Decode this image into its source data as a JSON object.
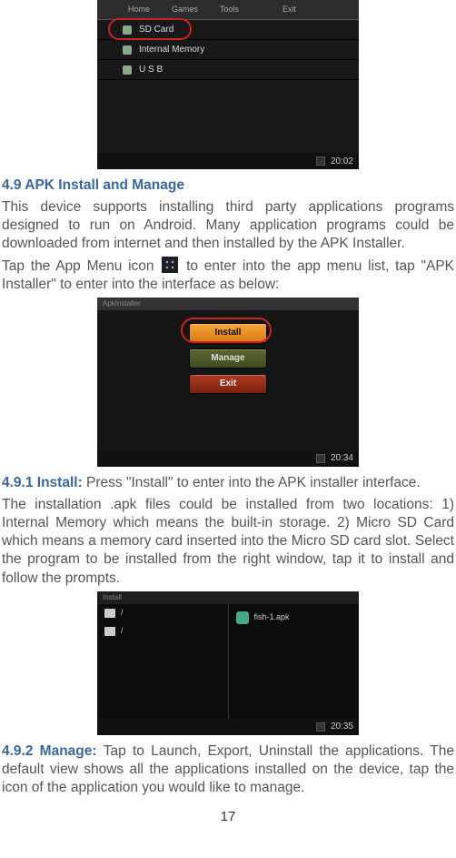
{
  "shot1": {
    "menu": [
      "Home",
      "Games",
      "Tools",
      "",
      "Exit"
    ],
    "rows": [
      "SD Card",
      "Internal Memory",
      "U S B"
    ],
    "time": "20:02"
  },
  "section49": {
    "heading": "4.9 APK Install and Manage",
    "p1": "This device supports installing third party applications programs designed to run on Android. Many application programs could be downloaded from internet and then installed by the APK Installer.",
    "p2a": "Tap the App Menu icon ",
    "p2b": " to enter into the app menu list, tap \"APK Installer\" to enter into the interface as below:"
  },
  "shot2": {
    "title": "ApkInstaller",
    "install": "Install",
    "manage": "Manage",
    "exit": "Exit",
    "time": "20:34"
  },
  "section491": {
    "heading": "4.9.1 Install: ",
    "trail": "Press \"Install\" to enter into the APK installer interface.",
    "p": "The installation .apk files could be installed from two locations: 1) Internal Memory which means the built-in storage. 2) Micro SD Card which means a memory card inserted into the Micro SD card slot. Select the program to be installed from the right window, tap it to install and follow the prompts."
  },
  "shot3": {
    "title": "Install",
    "paths": [
      "/",
      "/"
    ],
    "apk": "fish-1.apk",
    "time": "20:35"
  },
  "section492": {
    "heading": "4.9.2 Manage: ",
    "trail": "Tap to Launch, Export, Uninstall the applications. The default view shows all the applications installed on the device, tap the icon of the application you would like to manage."
  },
  "pagenum": "17"
}
